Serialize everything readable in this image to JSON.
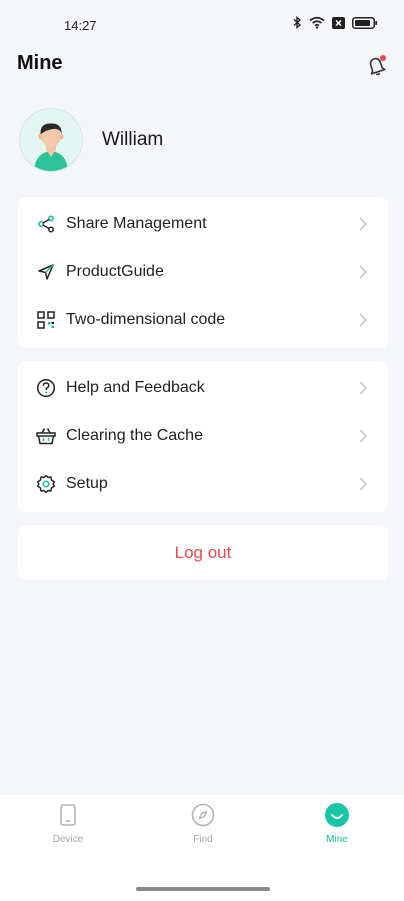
{
  "status_bar": {
    "time": "14:27"
  },
  "header": {
    "title": "Mine"
  },
  "profile": {
    "name": "William"
  },
  "menu_group_1": [
    {
      "label": "Share Management",
      "icon": "share-icon"
    },
    {
      "label": "ProductGuide",
      "icon": "navigation-arrow-icon"
    },
    {
      "label": "Two-dimensional code",
      "icon": "qr-code-icon"
    }
  ],
  "menu_group_2": [
    {
      "label": "Help and Feedback",
      "icon": "help-icon"
    },
    {
      "label": "Clearing the Cache",
      "icon": "basket-icon"
    },
    {
      "label": "Setup",
      "icon": "settings-gear-icon"
    }
  ],
  "logout_label": "Log out",
  "tabs": [
    {
      "label": "Device",
      "icon": "device-icon",
      "active": false
    },
    {
      "label": "Find",
      "icon": "compass-icon",
      "active": false
    },
    {
      "label": "Mine",
      "icon": "smiley-icon",
      "active": true
    }
  ],
  "colors": {
    "accent": "#19c5a5",
    "danger": "#e84a4a",
    "background": "#f5f6fa",
    "notification_dot": "#f04848"
  }
}
